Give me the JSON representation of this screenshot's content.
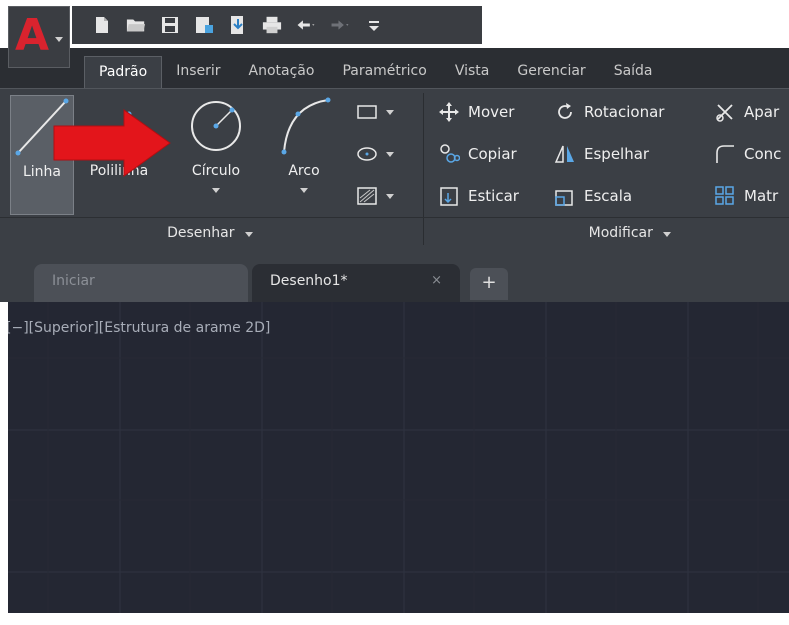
{
  "quick_access": {
    "icons": [
      "new-file-icon",
      "open-folder-icon",
      "save-icon",
      "save-as-icon",
      "cloud-open-icon",
      "print-icon",
      "undo-icon",
      "redo-icon",
      "customize-qat-icon"
    ]
  },
  "ribbon_tabs": [
    {
      "label": "Padrão",
      "active": true
    },
    {
      "label": "Inserir",
      "active": false
    },
    {
      "label": "Anotação",
      "active": false
    },
    {
      "label": "Paramétrico",
      "active": false
    },
    {
      "label": "Vista",
      "active": false
    },
    {
      "label": "Gerenciar",
      "active": false
    },
    {
      "label": "Saída",
      "active": false
    }
  ],
  "draw_panel": {
    "title": "Desenhar",
    "tools": {
      "line": "Linha",
      "polyline": "Polilinha",
      "circle": "Círculo",
      "arc": "Arco"
    }
  },
  "modify_panel": {
    "title": "Modificar",
    "tools": {
      "move": "Mover",
      "rotate": "Rotacionar",
      "trim": "Apar",
      "copy": "Copiar",
      "mirror": "Espelhar",
      "fillet": "Conc",
      "stretch": "Esticar",
      "scale": "Escala",
      "array": "Matr"
    }
  },
  "file_tabs": {
    "start": "Iniciar",
    "document": "Desenho1*",
    "close": "×",
    "add": "+"
  },
  "viewport": {
    "label": "[−][Superior][Estrutura de arame 2D]"
  },
  "colors": {
    "ribbon_bg": "#3b3f45",
    "canvas_bg": "#242733",
    "accent_red": "#e3151b",
    "autocad_red": "#d9232e"
  }
}
